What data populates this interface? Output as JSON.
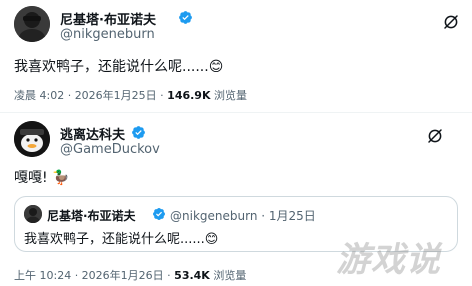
{
  "tweet1": {
    "name": "尼基塔·布亚诺夫",
    "handle": "@nikgeneburn",
    "text": "我喜欢鸭子，还能说什么呢......",
    "emoji": "😊",
    "time": "凌晨 4:02 · 2026年1月25日 · ",
    "views_count": "146.9K",
    "views_label": " 浏览量"
  },
  "tweet2": {
    "name": "逃离达科夫",
    "handle": "@GameDuckov",
    "text": "嘎嘎! ",
    "emoji": "🦆",
    "quote": {
      "name": "尼基塔·布亚诺夫",
      "handle": "@nikgeneburn · 1月25日",
      "text": "我喜欢鸭子，还能说什么呢......",
      "emoji": "😊"
    },
    "time": "上午 10:24 · 2026年1月26日 · ",
    "views_count": "53.4K",
    "views_label": " 浏览量"
  },
  "icons": {
    "verified": "verified-badge-icon",
    "grok": "grok-icon"
  },
  "watermark": "游戏说",
  "colors": {
    "verified": "#1d9bf0",
    "secondary_text": "#536471"
  }
}
